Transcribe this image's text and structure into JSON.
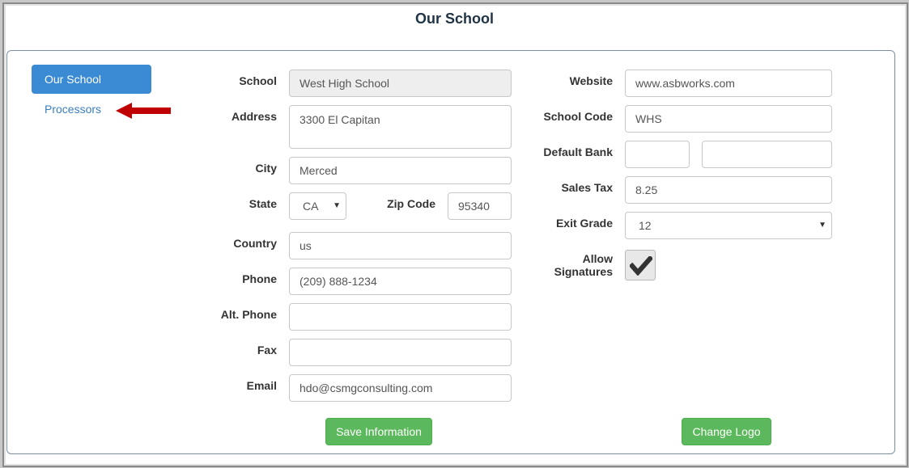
{
  "header": {
    "title": "Our School"
  },
  "sidebar": {
    "items": [
      {
        "label": "Our School",
        "active": true
      },
      {
        "label": "Processors",
        "active": false
      }
    ],
    "arrow_color": "#c00000"
  },
  "form_left": {
    "school": {
      "label": "School",
      "value": "West High School"
    },
    "address": {
      "label": "Address",
      "value": "3300 El Capitan"
    },
    "city": {
      "label": "City",
      "value": "Merced"
    },
    "state": {
      "label": "State",
      "value": "CA"
    },
    "zip": {
      "label": "Zip Code",
      "value": "95340"
    },
    "country": {
      "label": "Country",
      "value": "us"
    },
    "phone": {
      "label": "Phone",
      "value": "(209) 888-1234"
    },
    "alt_phone": {
      "label": "Alt. Phone",
      "value": ""
    },
    "fax": {
      "label": "Fax",
      "value": ""
    },
    "email": {
      "label": "Email",
      "value": "hdo@csmgconsulting.com"
    }
  },
  "form_right": {
    "website": {
      "label": "Website",
      "value": "www.asbworks.com"
    },
    "school_code": {
      "label": "School Code",
      "value": "WHS"
    },
    "default_bank": {
      "label": "Default Bank",
      "value1": "",
      "value2": ""
    },
    "sales_tax": {
      "label": "Sales Tax",
      "value": "8.25"
    },
    "exit_grade": {
      "label": "Exit Grade",
      "value": "12"
    },
    "allow_signatures": {
      "label_line1": "Allow",
      "label_line2": "Signatures",
      "checked": true
    }
  },
  "buttons": {
    "save_label": "Save Information",
    "logo_label": "Change Logo",
    "color": "#5cb85c"
  },
  "icons": {
    "select_caret": "▼",
    "checkmark": "check-icon",
    "arrow": "left-arrow-icon"
  }
}
